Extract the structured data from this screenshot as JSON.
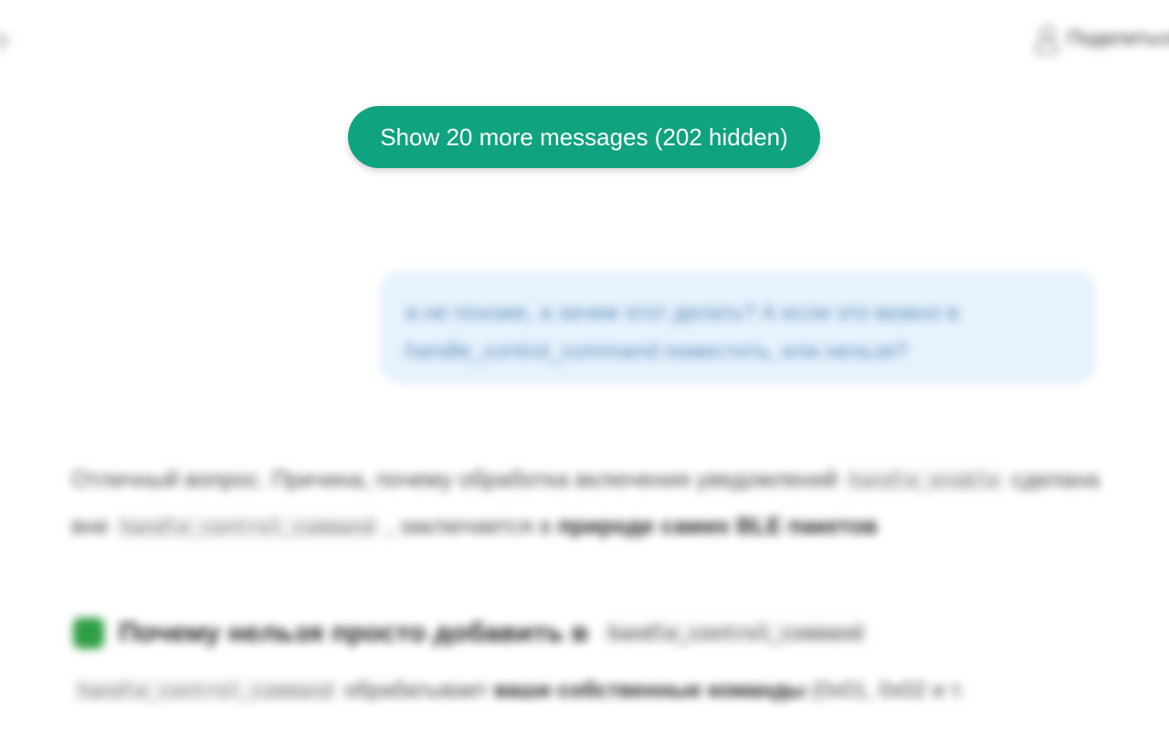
{
  "header": {
    "left_text": "ly",
    "right_text": "Поделиться",
    "right_icon": "user-icon"
  },
  "load_more": {
    "label": "Show 20 more messages (202 hidden)"
  },
  "user_message": {
    "text": "а не похоже, а зачем этот делать? А если это можно в handle_control_command поместить, или нельзя?"
  },
  "assistant_message": {
    "paragraph_start": "Отличный вопрос. Причина, почему обработка включения уведомлений",
    "code_1": "handle_enable",
    "paragraph_mid_1": "сделана вне",
    "code_2": "handle_control_command",
    "paragraph_mid_2": ", заключается в",
    "paragraph_bold": "природе самих BLE пакетов",
    "heading_prefix": "Почему нельзя просто добавить в",
    "heading_code": "handle_control_command",
    "last_code": "handle_control_command",
    "last_text": "обрабатывает",
    "last_bold": "ваши собственные команды",
    "last_tail": "(0x01, 0x02 и т."
  },
  "colors": {
    "accent": "#10a37f",
    "user_bubble": "#e6f2fd",
    "check": "#2e9e44"
  }
}
